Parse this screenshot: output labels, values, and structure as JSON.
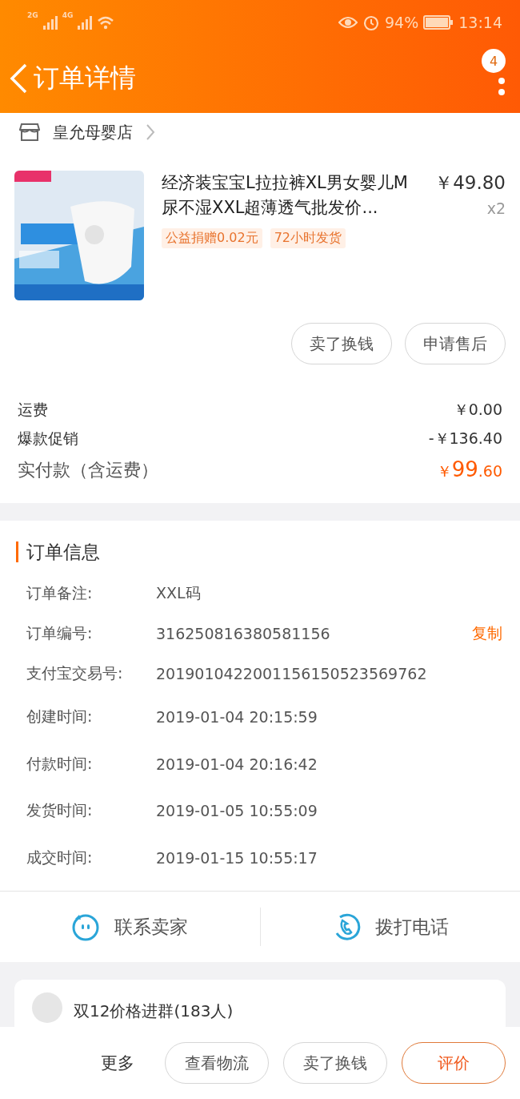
{
  "status_bar": {
    "networks": [
      "2G",
      "4G"
    ],
    "battery": "94%",
    "time": "13:14"
  },
  "header": {
    "title": "订单详情",
    "badge": "4"
  },
  "shop": {
    "name": "皇允母婴店"
  },
  "product": {
    "title": "经济装宝宝L拉拉裤XL男女婴儿M尿不湿XXL超薄透气批发价...",
    "price": "￥49.80",
    "quantity": "x2",
    "tags": [
      "公益捐赠0.02元",
      "72小时发货"
    ]
  },
  "product_actions": [
    "卖了换钱",
    "申请售后"
  ],
  "fees": [
    {
      "label": "运费",
      "value": "￥0.00"
    },
    {
      "label": "爆款促销",
      "value": "-￥136.40"
    }
  ],
  "total": {
    "label": "实付款（含运费）",
    "currency": "￥",
    "integer": "99",
    "decimal": ".60"
  },
  "order_info": {
    "title": "订单信息",
    "rows": [
      {
        "label": "订单备注:",
        "value": "XXL码"
      },
      {
        "label": "订单编号:",
        "value": "316250816380581156",
        "action": "复制"
      },
      {
        "label": "支付宝交易号:",
        "value": "2019010422001156150523569762"
      },
      {
        "label": "创建时间:",
        "value": "2019-01-04 20:15:59"
      },
      {
        "label": "付款时间:",
        "value": "2019-01-04 20:16:42"
      },
      {
        "label": "发货时间:",
        "value": "2019-01-05 10:55:09"
      },
      {
        "label": "成交时间:",
        "value": "2019-01-15 10:55:17"
      }
    ]
  },
  "contact": [
    {
      "kind": "chat",
      "label": "联系卖家"
    },
    {
      "kind": "phone",
      "label": "拨打电话"
    }
  ],
  "group": {
    "name": "双12价格进群(183人)"
  },
  "bottom_bar": {
    "more": "更多",
    "buttons": [
      {
        "label": "查看物流",
        "highlighted": false
      },
      {
        "label": "卖了换钱",
        "highlighted": false
      },
      {
        "label": "评价",
        "highlighted": true
      }
    ]
  }
}
